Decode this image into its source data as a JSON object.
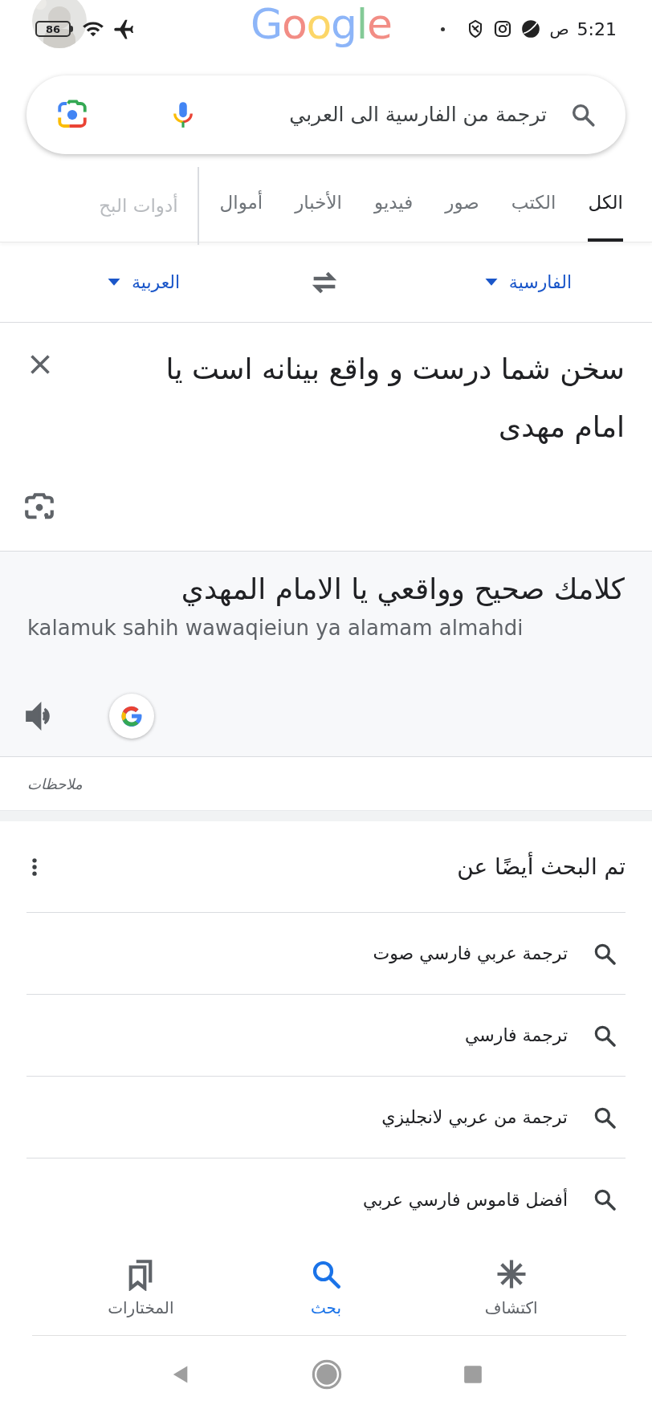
{
  "status_bar": {
    "battery": "86",
    "am_pm": "ص",
    "time": "5:21"
  },
  "logo": "Google",
  "search": {
    "query": "ترجمة من الفارسية الى العربي"
  },
  "tabs": [
    {
      "label": "الكل",
      "selected": true
    },
    {
      "label": "الكتب",
      "selected": false
    },
    {
      "label": "صور",
      "selected": false
    },
    {
      "label": "فيديو",
      "selected": false
    },
    {
      "label": "الأخبار",
      "selected": false
    },
    {
      "label": "أموال",
      "selected": false
    }
  ],
  "search_tools": "أدوات البح",
  "translator": {
    "source_language": "الفارسية",
    "target_language": "العربية",
    "source_text": "سخن شما درست و واقع بینانه است یا امام مهدی",
    "translation": "كلامك صحيح وواقعي يا الامام المهدي",
    "romanization": "kalamuk sahih wawaqieiun ya alamam almahdi",
    "notes": "ملاحظات"
  },
  "related": {
    "title": "تم البحث أيضًا عن",
    "items": [
      "ترجمة عربي فارسي صوت",
      "ترجمة فارسي",
      "ترجمة من عربي لانجليزي",
      "أفضل قاموس فارسي عربي"
    ]
  },
  "bottom_nav": [
    {
      "kind": "discover",
      "label": "اكتشاف",
      "selected": false
    },
    {
      "kind": "search",
      "label": "بحث",
      "selected": true
    },
    {
      "kind": "saved",
      "label": "المختارات",
      "selected": false
    }
  ]
}
